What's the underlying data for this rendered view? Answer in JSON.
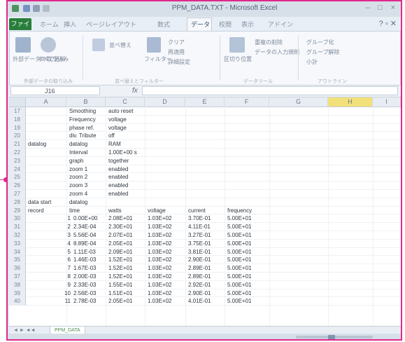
{
  "app": {
    "title": "PPM_DATA.TXT - Microsoft Excel",
    "window_controls": [
      "–",
      "□",
      "×"
    ]
  },
  "ribbon_tabs": [
    "ファイル",
    "ホーム",
    "挿入",
    "ページレイアウト",
    "数式",
    "データ",
    "校閲",
    "表示",
    "アドイン"
  ],
  "ribbon": {
    "active_tab_index": 5,
    "groups": [
      {
        "label": "外部データの取り込み",
        "items": [
          "外部データの取り込み",
          "すべて更新"
        ]
      },
      {
        "label": "並べ替えとフィルター",
        "items": [
          "並べ替え",
          "フィルター",
          "クリア",
          "再適用",
          "詳細設定"
        ]
      },
      {
        "label": "データツール",
        "items": [
          "区切り位置",
          "重複の削除",
          "データの入力規則"
        ]
      },
      {
        "label": "アウトライン",
        "items": [
          "グループ化",
          "グループ解除",
          "小計"
        ]
      }
    ]
  },
  "formula_bar": {
    "name_box": "J16",
    "fx": "fx",
    "value": ""
  },
  "columns": [
    "A",
    "B",
    "C",
    "D",
    "E",
    "F",
    "G",
    "H",
    "I"
  ],
  "rows": [
    {
      "n": "17",
      "a": "",
      "b": "Smoothing",
      "c": "auto reset",
      "d": "",
      "e": "",
      "f": ""
    },
    {
      "n": "18",
      "a": "",
      "b": "Frequency",
      "c": "voltage",
      "d": "",
      "e": "",
      "f": ""
    },
    {
      "n": "19",
      "a": "",
      "b": "phase ref.",
      "c": "voltage",
      "d": "",
      "e": "",
      "f": ""
    },
    {
      "n": "20",
      "a": "",
      "b": "div. Tribute",
      "c": "off",
      "d": "",
      "e": "",
      "f": ""
    },
    {
      "n": "21",
      "a": "datalog",
      "b": "datalog",
      "c": "RAM",
      "d": "",
      "e": "",
      "f": ""
    },
    {
      "n": "22",
      "a": "",
      "b": "Interval",
      "c": "1.00E+00 s",
      "d": "",
      "e": "",
      "f": ""
    },
    {
      "n": "23",
      "a": "",
      "b": "graph",
      "c": "together",
      "d": "",
      "e": "",
      "f": ""
    },
    {
      "n": "24",
      "a": "",
      "b": "zoom 1",
      "c": "enabled",
      "d": "",
      "e": "",
      "f": ""
    },
    {
      "n": "25",
      "a": "",
      "b": "zoom 2",
      "c": "enabled",
      "d": "",
      "e": "",
      "f": ""
    },
    {
      "n": "26",
      "a": "",
      "b": "zoom 3",
      "c": "enabled",
      "d": "",
      "e": "",
      "f": ""
    },
    {
      "n": "27",
      "a": "",
      "b": "zoom 4",
      "c": "enabled",
      "d": "",
      "e": "",
      "f": ""
    },
    {
      "n": "28",
      "a": "data start",
      "b": "datalog",
      "c": "",
      "d": "",
      "e": "",
      "f": ""
    },
    {
      "n": "29",
      "a": "record",
      "b": "time",
      "c": "watts",
      "d": "voltage",
      "e": "current",
      "f": "frequency"
    },
    {
      "n": "30",
      "a": "",
      "b": "1",
      "b2": "0.00E+00",
      "c": "2.08E+01",
      "d": "1.03E+02",
      "e": "3.70E-01",
      "f": "5.00E+01"
    },
    {
      "n": "31",
      "a": "",
      "b": "2",
      "b2": "2.34E-04",
      "c": "2.30E+01",
      "d": "1.03E+02",
      "e": "4.11E-01",
      "f": "5.00E+01"
    },
    {
      "n": "32",
      "a": "",
      "b": "3",
      "b2": "5.56E-04",
      "c": "2.07E+01",
      "d": "1.03E+02",
      "e": "3.27E-01",
      "f": "5.00E+01"
    },
    {
      "n": "33",
      "a": "",
      "b": "4",
      "b2": "8.89E-04",
      "c": "2.05E+01",
      "d": "1.03E+02",
      "e": "3.75E-01",
      "f": "5.00E+01"
    },
    {
      "n": "34",
      "a": "",
      "b": "5",
      "b2": "1.11E-03",
      "c": "2.09E+01",
      "d": "1.03E+02",
      "e": "3.81E-01",
      "f": "5.00E+01"
    },
    {
      "n": "35",
      "a": "",
      "b": "6",
      "b2": "1.46E-03",
      "c": "1.52E+01",
      "d": "1.03E+02",
      "e": "2.90E-01",
      "f": "5.00E+01"
    },
    {
      "n": "36",
      "a": "",
      "b": "7",
      "b2": "1.67E-03",
      "c": "1.52E+01",
      "d": "1.03E+02",
      "e": "2.89E-01",
      "f": "5.00E+01"
    },
    {
      "n": "37",
      "a": "",
      "b": "8",
      "b2": "2.00E-03",
      "c": "1.52E+01",
      "d": "1.03E+02",
      "e": "2.89E-01",
      "f": "5.00E+01"
    },
    {
      "n": "38",
      "a": "",
      "b": "9",
      "b2": "2.33E-03",
      "c": "1.55E+01",
      "d": "1.03E+02",
      "e": "2.92E-01",
      "f": "5.00E+01"
    },
    {
      "n": "39",
      "a": "",
      "b": "10",
      "b2": "2.56E-03",
      "c": "1.51E+01",
      "d": "1.03E+02",
      "e": "2.90E-01",
      "f": "5.00E+01"
    },
    {
      "n": "40",
      "a": "",
      "b": "11",
      "b2": "2.78E-03",
      "c": "2.05E+01",
      "d": "1.03E+02",
      "e": "4.01E-01",
      "f": "5.00E+01"
    }
  ],
  "sheet": {
    "tab_label": "PPM_DATA",
    "nav": "◄ ► ◄◄"
  },
  "status": {
    "zoom_fraction": 0.46
  },
  "colors": {
    "frame": "#e0288c",
    "file_tab": "#2a7e3c",
    "selected_col_header": "#f2e07a"
  }
}
